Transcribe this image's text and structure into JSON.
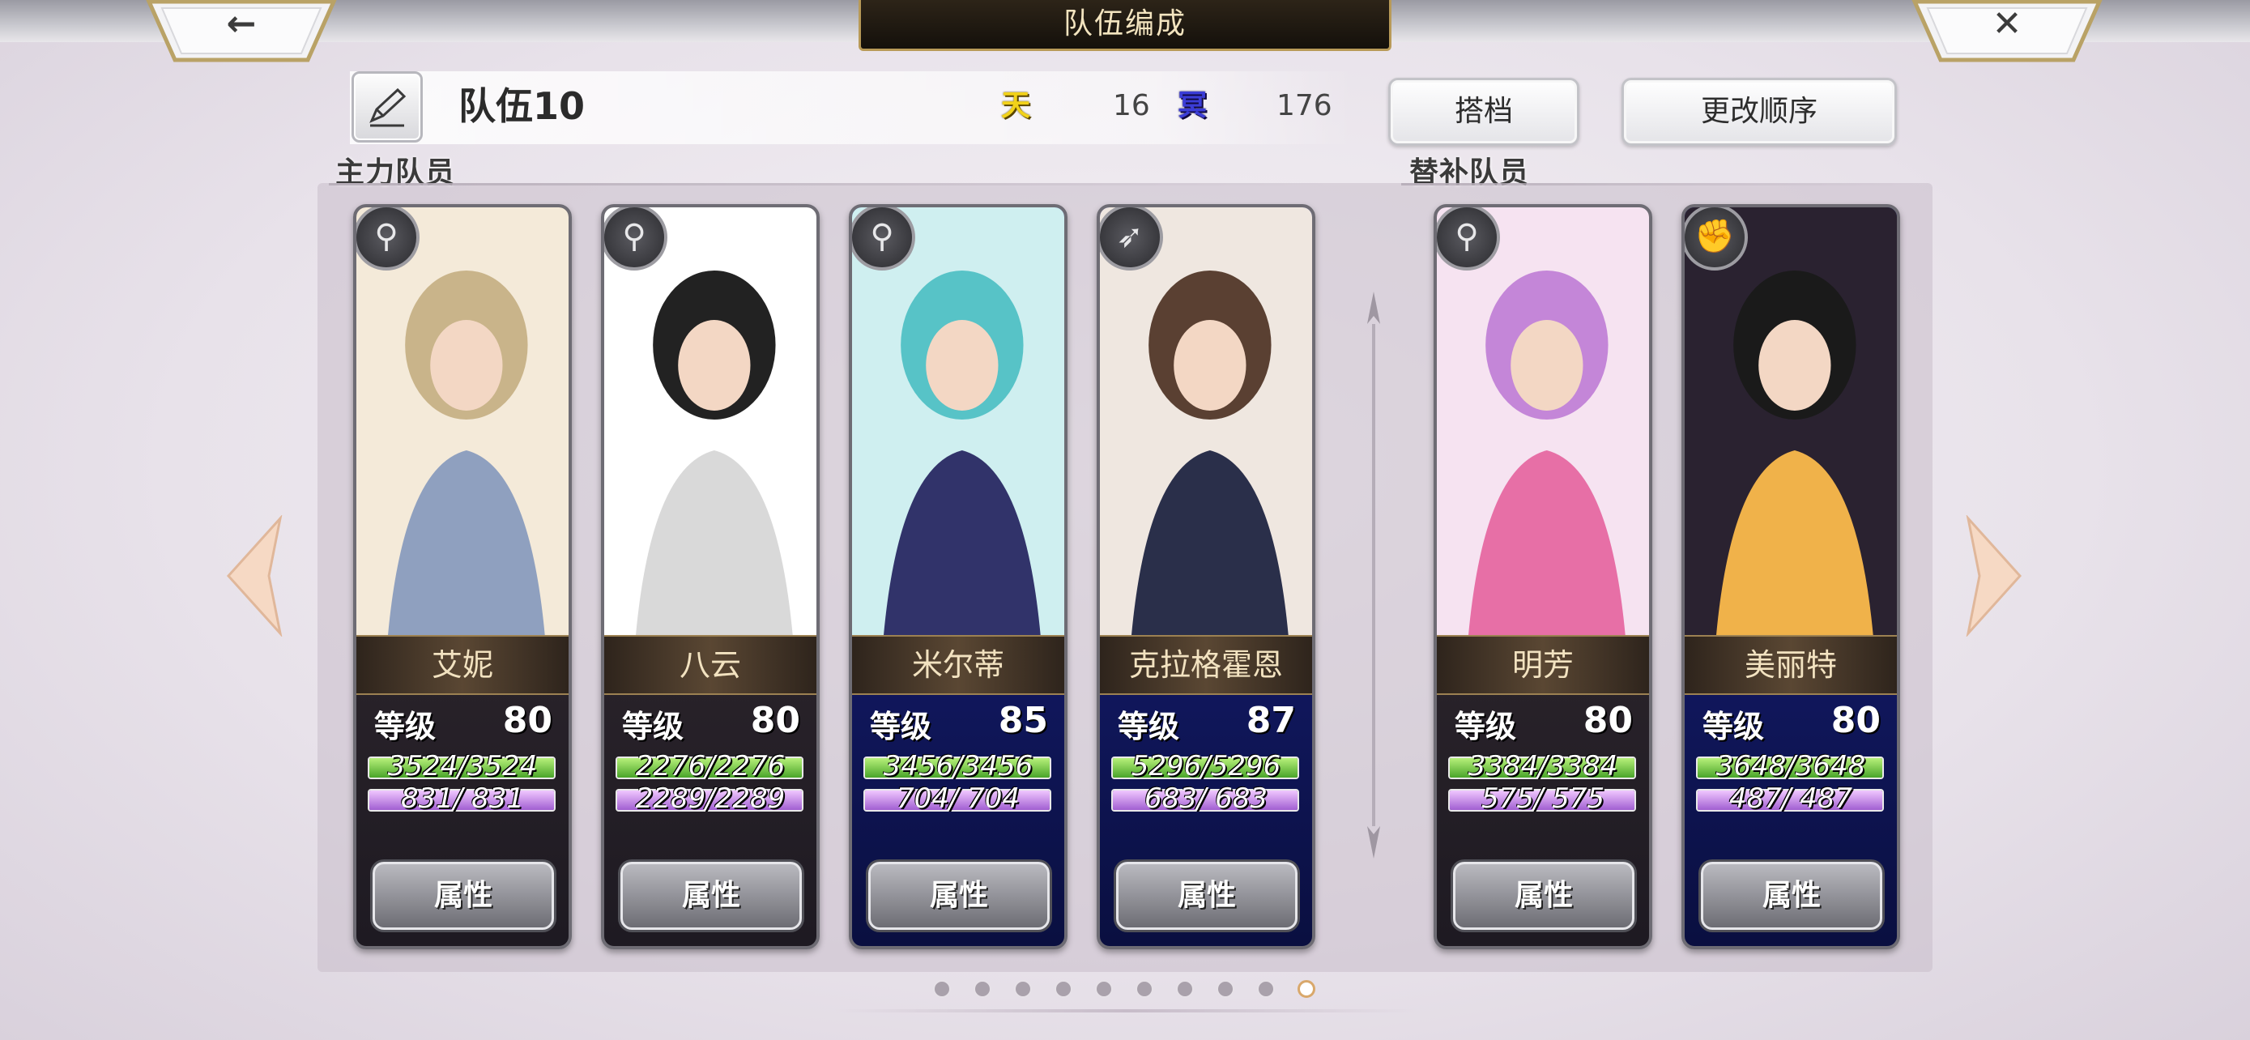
{
  "header": {
    "title": "队伍编成",
    "back_icon": "←",
    "close_icon": "✕"
  },
  "team": {
    "name": "队伍10",
    "heaven_badge": "天",
    "heaven_count": "16",
    "dark_badge": "冥",
    "dark_count": "176"
  },
  "buttons": {
    "partner": "搭档",
    "change_order": "更改顺序"
  },
  "sections": {
    "main": "主力队员",
    "reserve": "替补队员"
  },
  "cards": [
    {
      "name": "艾妮",
      "level_label": "等级",
      "level": "80",
      "hp": "3524/3524",
      "mp": "831/ 831",
      "attr": "属性",
      "weapon_icon": "staff-icon"
    },
    {
      "name": "八云",
      "level_label": "等级",
      "level": "80",
      "hp": "2276/2276",
      "mp": "2289/2289",
      "attr": "属性",
      "weapon_icon": "staff-icon"
    },
    {
      "name": "米尔蒂",
      "level_label": "等级",
      "level": "85",
      "hp": "3456/3456",
      "mp": "704/ 704",
      "attr": "属性",
      "weapon_icon": "staff-icon"
    },
    {
      "name": "克拉格霍恩",
      "level_label": "等级",
      "level": "87",
      "hp": "5296/5296",
      "mp": "683/ 683",
      "attr": "属性",
      "weapon_icon": "spear-icon"
    },
    {
      "name": "明芳",
      "level_label": "等级",
      "level": "80",
      "hp": "3384/3384",
      "mp": "575/ 575",
      "attr": "属性",
      "weapon_icon": "staff-icon"
    },
    {
      "name": "美丽特",
      "level_label": "等级",
      "level": "80",
      "hp": "3648/3648",
      "mp": "487/ 487",
      "attr": "属性",
      "weapon_icon": "fist-icon"
    }
  ],
  "pagination": {
    "total": 10,
    "current": 10
  },
  "colors": {
    "heaven": "#f2d21a",
    "dark": "#3b3dd6",
    "hp_bar": "#4aa52a",
    "mp_bar": "#a15fd1"
  }
}
